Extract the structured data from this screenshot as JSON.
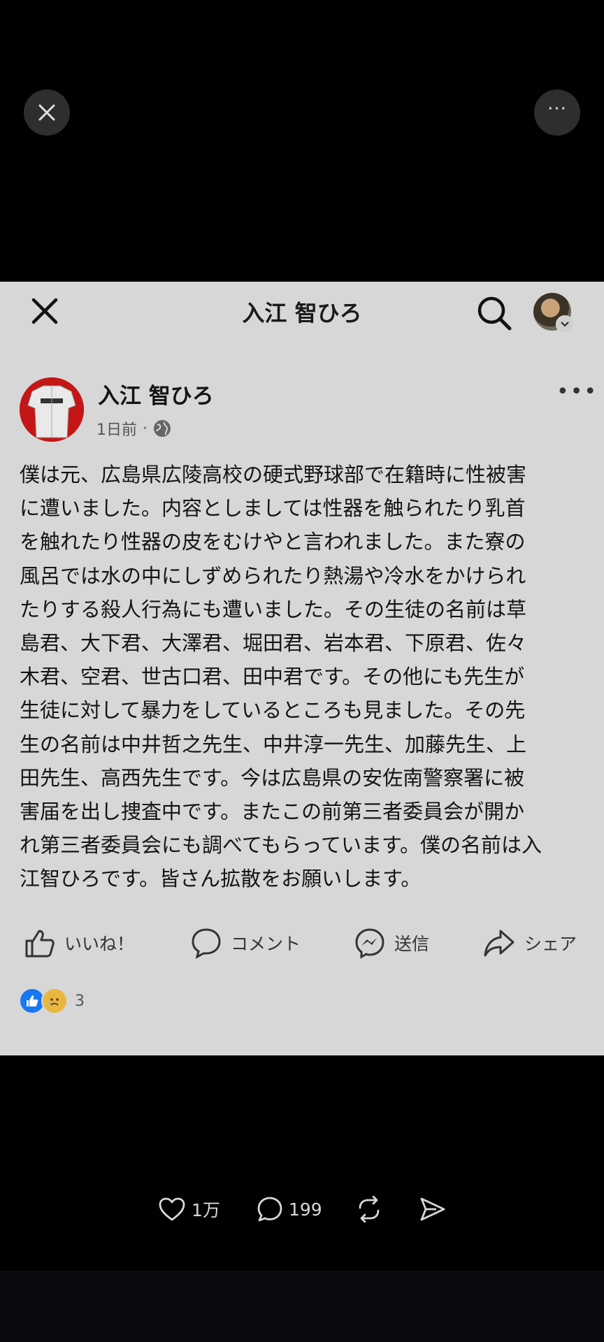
{
  "viewer": {
    "close_icon": "close-icon",
    "more_icon": "more-horizontal-icon",
    "more_label": "···"
  },
  "fb_screenshot": {
    "header": {
      "title": "入江 智ひろ",
      "close_icon": "close-icon",
      "search_icon": "search-icon",
      "avatar_icon": "profile-avatar"
    },
    "post": {
      "author": "入江 智ひろ",
      "time": "1日前",
      "separator": "·",
      "privacy_icon": "globe-icon",
      "more_label": "•••",
      "body": "僕は元、広島県広陵高校の硬式野球部で在籍時に性被害\nに遭いました。内容としましては性器を触られたり乳首\nを触れたり性器の皮をむけやと言われました。また寮の\n風呂では水の中にしずめられたり熱湯や冷水をかけられ\nたりする殺人行為にも遭いました。その生徒の名前は草\n島君、大下君、大澤君、堀田君、岩本君、下原君、佐々\n木君、空君、世古口君、田中君です。その他にも先生が\n生徒に対して暴力をしているところも見ました。その先\n生の名前は中井哲之先生、中井淳一先生、加藤先生、上\n田先生、高西先生です。今は広島県の安佐南警察署に被\n害届を出し捜査中です。またこの前第三者委員会が開か\nれ第三者委員会にも調べてもらっています。僕の名前は入\n江智ひろです。皆さん拡散をお願いします。",
      "actions": {
        "like": "いいね！",
        "comment": "コメント",
        "send": "送信",
        "share": "シェア"
      },
      "reaction_count": "3",
      "reaction_colors": {
        "like": "#1877f2",
        "sad": "#e9b640"
      }
    }
  },
  "bottom_actions": {
    "likes": "1万",
    "replies": "199",
    "repost_icon": "repost-icon",
    "share_icon": "share-icon"
  }
}
